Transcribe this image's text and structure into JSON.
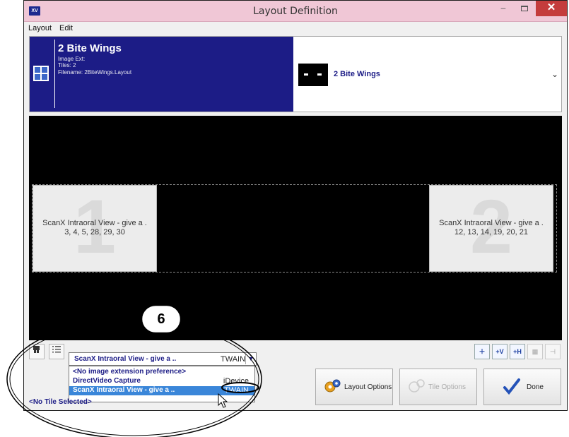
{
  "window": {
    "app_icon_text": "XV",
    "title": "Layout Definition",
    "minimize": "–",
    "close": "✕"
  },
  "menu": [
    "Layout",
    "Edit"
  ],
  "layout_card": {
    "name": "2 Bite Wings",
    "image_ext": "Image Ext:",
    "tiles": "Tiles: 2",
    "filename": "Filename: 2BiteWings.Layout"
  },
  "preview_label": "2 Bite Wings",
  "tiles": [
    {
      "number": "1",
      "line1": "ScanX Intraoral View - give a .",
      "line2": "3, 4, 5, 28, 29, 30"
    },
    {
      "number": "2",
      "line1": "ScanX Intraoral View - give a .",
      "line2": "12, 13, 14, 19, 20, 21"
    }
  ],
  "extension_select": {
    "value": "ScanX Intraoral View - give a ..",
    "kind": "TWAIN"
  },
  "dropdown_options": [
    {
      "name": "<No image extension preference>",
      "kind": ""
    },
    {
      "name": "DirectVideo Capture",
      "kind": "iDevice"
    },
    {
      "name": "ScanX Intraoral View - give a ..",
      "kind": "TWAIN"
    }
  ],
  "status": "<No Tile Selected>",
  "buttons": {
    "layout_options": "Layout Options",
    "tile_options": "Tile Options",
    "done": "Done"
  },
  "callout_number": "6",
  "colors": {
    "title_bar": "#f0c7d6",
    "card_bg": "#1c1c86",
    "selection": "#3a86d9",
    "close": "#c43c3c"
  }
}
